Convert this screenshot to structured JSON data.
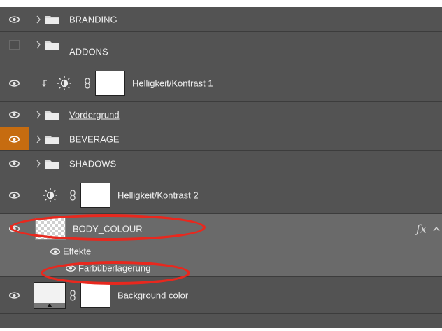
{
  "layers": {
    "branding": {
      "name": "BRANDING",
      "visible": true
    },
    "addons": {
      "name": "ADDONS",
      "visible": false
    },
    "hk1": {
      "name": "Helligkeit/Kontrast 1",
      "visible": true
    },
    "vordergrund": {
      "name": "Vordergrund",
      "visible": true
    },
    "beverage": {
      "name": "BEVERAGE",
      "visible": true
    },
    "shadows": {
      "name": "SHADOWS",
      "visible": true
    },
    "hk2": {
      "name": "Helligkeit/Kontrast 2",
      "visible": true
    },
    "body": {
      "name": "BODY_COLOUR",
      "visible": true,
      "fx_label": "fx"
    },
    "effects": {
      "label": "Effekte"
    },
    "overlay": {
      "label": "Farbüberlagerung"
    },
    "background": {
      "name": "Background color",
      "visible": true
    }
  },
  "colors": {
    "panel": "#535353",
    "selected_row": "#6a6a6a",
    "eye_highlight": "#c66c10",
    "annotation": "#e8281e"
  },
  "icons": {
    "eye": "eye-icon",
    "chevron": "chevron-right-icon",
    "folder": "folder-icon",
    "adjustment": "brightness-contrast-icon",
    "link": "chain-link-icon",
    "clip": "clipping-arrow-icon",
    "collapse": "chevron-up-icon"
  }
}
